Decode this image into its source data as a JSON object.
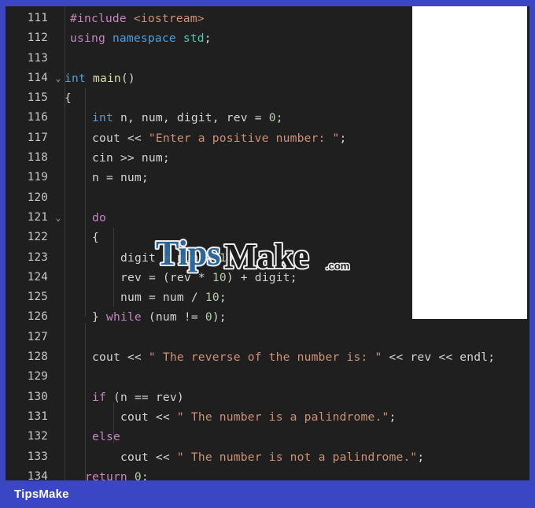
{
  "window": {
    "frame_color": "#3b46c4",
    "editor_background": "#1f1f1f",
    "language": "cpp"
  },
  "footer": {
    "brand": "TipsMake"
  },
  "watermark": {
    "text": "TipsMake",
    "suffix": ".com"
  },
  "editor": {
    "first_line_number": 111,
    "last_line_number": 134,
    "lines": [
      {
        "number": "111",
        "fold": "",
        "text": "#include <iostream>"
      },
      {
        "number": "112",
        "fold": "",
        "text": "using namespace std;"
      },
      {
        "number": "113",
        "fold": "",
        "text": ""
      },
      {
        "number": "114",
        "fold": "⌄",
        "text": "int main()"
      },
      {
        "number": "115",
        "fold": "",
        "text": "{"
      },
      {
        "number": "116",
        "fold": "",
        "text": "    int n, num, digit, rev = 0;"
      },
      {
        "number": "117",
        "fold": "",
        "text": "    cout << \"Enter a positive number: \";"
      },
      {
        "number": "118",
        "fold": "",
        "text": "    cin >> num;"
      },
      {
        "number": "119",
        "fold": "",
        "text": "    n = num;"
      },
      {
        "number": "120",
        "fold": "",
        "text": ""
      },
      {
        "number": "121",
        "fold": "⌄",
        "text": "    do"
      },
      {
        "number": "122",
        "fold": "",
        "text": "    {"
      },
      {
        "number": "123",
        "fold": "",
        "text": "        digit = num % 10;"
      },
      {
        "number": "124",
        "fold": "",
        "text": "        rev = (rev * 10) + digit;"
      },
      {
        "number": "125",
        "fold": "",
        "text": "        num = num / 10;"
      },
      {
        "number": "126",
        "fold": "",
        "text": "    } while (num != 0);"
      },
      {
        "number": "127",
        "fold": "",
        "text": ""
      },
      {
        "number": "128",
        "fold": "",
        "text": "    cout << \" The reverse of the number is: \" << rev << endl;"
      },
      {
        "number": "129",
        "fold": "",
        "text": ""
      },
      {
        "number": "130",
        "fold": "",
        "text": "    if (n == rev)"
      },
      {
        "number": "131",
        "fold": "",
        "text": "        cout << \" The number is a palindrome.\";"
      },
      {
        "number": "132",
        "fold": "",
        "text": "    else"
      },
      {
        "number": "133",
        "fold": "",
        "text": "        cout << \" The number is not a palindrome.\";"
      },
      {
        "number": "134",
        "fold": "",
        "text": "    return 0;"
      }
    ]
  },
  "colors": {
    "keyword_preprocessor": "#c586c0",
    "keyword_type": "#569cd6",
    "function_name": "#dcdcaa",
    "string": "#ce9178",
    "number": "#b5cea8",
    "namespace": "#4ec9b0",
    "plain_text": "#d4d4d4",
    "line_number": "#c8c8c8",
    "frame": "#3b46c4"
  }
}
